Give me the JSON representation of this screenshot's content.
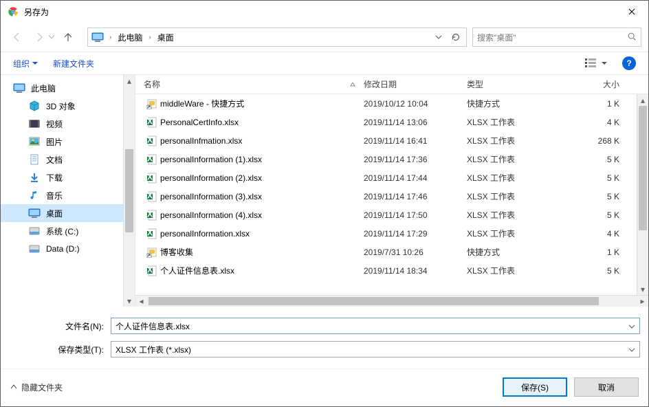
{
  "window": {
    "title": "另存为"
  },
  "breadcrumbs": {
    "pc": "此电脑",
    "desktop": "桌面"
  },
  "search": {
    "placeholder": "搜索\"桌面\""
  },
  "toolbar": {
    "organize": "组织",
    "newfolder": "新建文件夹"
  },
  "tree": {
    "thispc": "此电脑",
    "items": [
      {
        "label": "3D 对象",
        "icon": "3d"
      },
      {
        "label": "视频",
        "icon": "video"
      },
      {
        "label": "图片",
        "icon": "pictures"
      },
      {
        "label": "文档",
        "icon": "documents"
      },
      {
        "label": "下载",
        "icon": "downloads"
      },
      {
        "label": "音乐",
        "icon": "music"
      },
      {
        "label": "桌面",
        "icon": "desktop",
        "selected": true
      },
      {
        "label": "系统 (C:)",
        "icon": "drive"
      },
      {
        "label": "Data (D:)",
        "icon": "drive"
      }
    ]
  },
  "columns": {
    "name": "名称",
    "date": "修改日期",
    "type": "类型",
    "size": "大小"
  },
  "files": [
    {
      "name": "middleWare - 快捷方式",
      "date": "2019/10/12 10:04",
      "type": "快捷方式",
      "size": "1 K",
      "icon": "shortcut"
    },
    {
      "name": "PersonalCertInfo.xlsx",
      "date": "2019/11/14 13:06",
      "type": "XLSX 工作表",
      "size": "4 K",
      "icon": "xlsx"
    },
    {
      "name": "personalInfmation.xlsx",
      "date": "2019/11/14 16:41",
      "type": "XLSX 工作表",
      "size": "268 K",
      "icon": "xlsx"
    },
    {
      "name": "personalInformation (1).xlsx",
      "date": "2019/11/14 17:36",
      "type": "XLSX 工作表",
      "size": "5 K",
      "icon": "xlsx"
    },
    {
      "name": "personalInformation (2).xlsx",
      "date": "2019/11/14 17:44",
      "type": "XLSX 工作表",
      "size": "5 K",
      "icon": "xlsx"
    },
    {
      "name": "personalInformation (3).xlsx",
      "date": "2019/11/14 17:46",
      "type": "XLSX 工作表",
      "size": "5 K",
      "icon": "xlsx"
    },
    {
      "name": "personalInformation (4).xlsx",
      "date": "2019/11/14 17:50",
      "type": "XLSX 工作表",
      "size": "5 K",
      "icon": "xlsx"
    },
    {
      "name": "personalInformation.xlsx",
      "date": "2019/11/14 17:29",
      "type": "XLSX 工作表",
      "size": "4 K",
      "icon": "xlsx"
    },
    {
      "name": "博客收集",
      "date": "2019/7/31 10:26",
      "type": "快捷方式",
      "size": "1 K",
      "icon": "shortcut"
    },
    {
      "name": "个人证件信息表.xlsx",
      "date": "2019/11/14 18:34",
      "type": "XLSX 工作表",
      "size": "5 K",
      "icon": "xlsx"
    }
  ],
  "fields": {
    "filename_label": "文件名(N):",
    "filename_value": "个人证件信息表.xlsx",
    "type_label": "保存类型(T):",
    "type_value": "XLSX 工作表 (*.xlsx)"
  },
  "footer": {
    "hide": "隐藏文件夹",
    "save": "保存(S)",
    "cancel": "取消"
  }
}
